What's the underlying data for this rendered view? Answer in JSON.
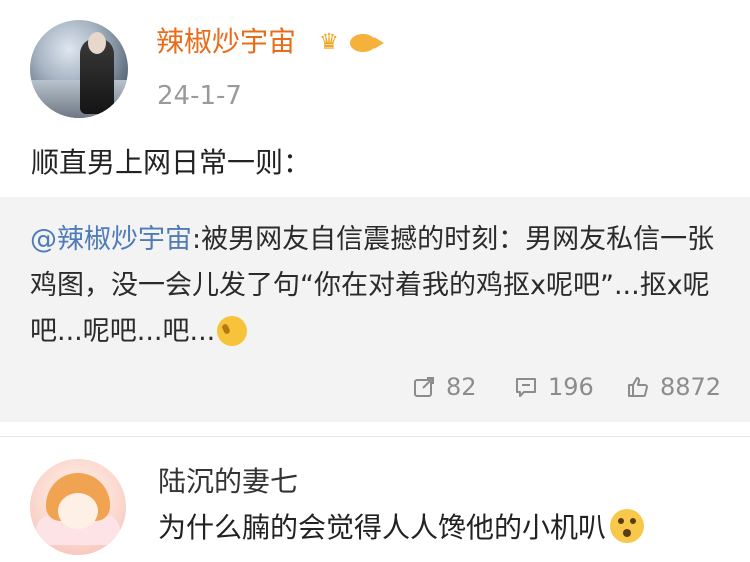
{
  "post": {
    "author": "辣椒炒宇宙",
    "date": "24-1-7",
    "text": "顺直男上网日常一则：",
    "badges": [
      "crown-icon",
      "fish-icon"
    ]
  },
  "repost": {
    "mention": "@辣椒炒宇宙",
    "text": ":被男网友自信震撼的时刻：男网友私信一张鸡图，没一会儿发了句“你在对着我的鸡抠x呢吧”...抠x呢吧...呢吧...吧...",
    "emoji": "facepalm-emoji"
  },
  "stats": {
    "reposts": "82",
    "comments": "196",
    "likes": "8872"
  },
  "comment": {
    "author": "陆沉的妻七",
    "text": "为什么腩的会觉得人人馋他的小机叭",
    "emoji": "shocked-emoji"
  }
}
